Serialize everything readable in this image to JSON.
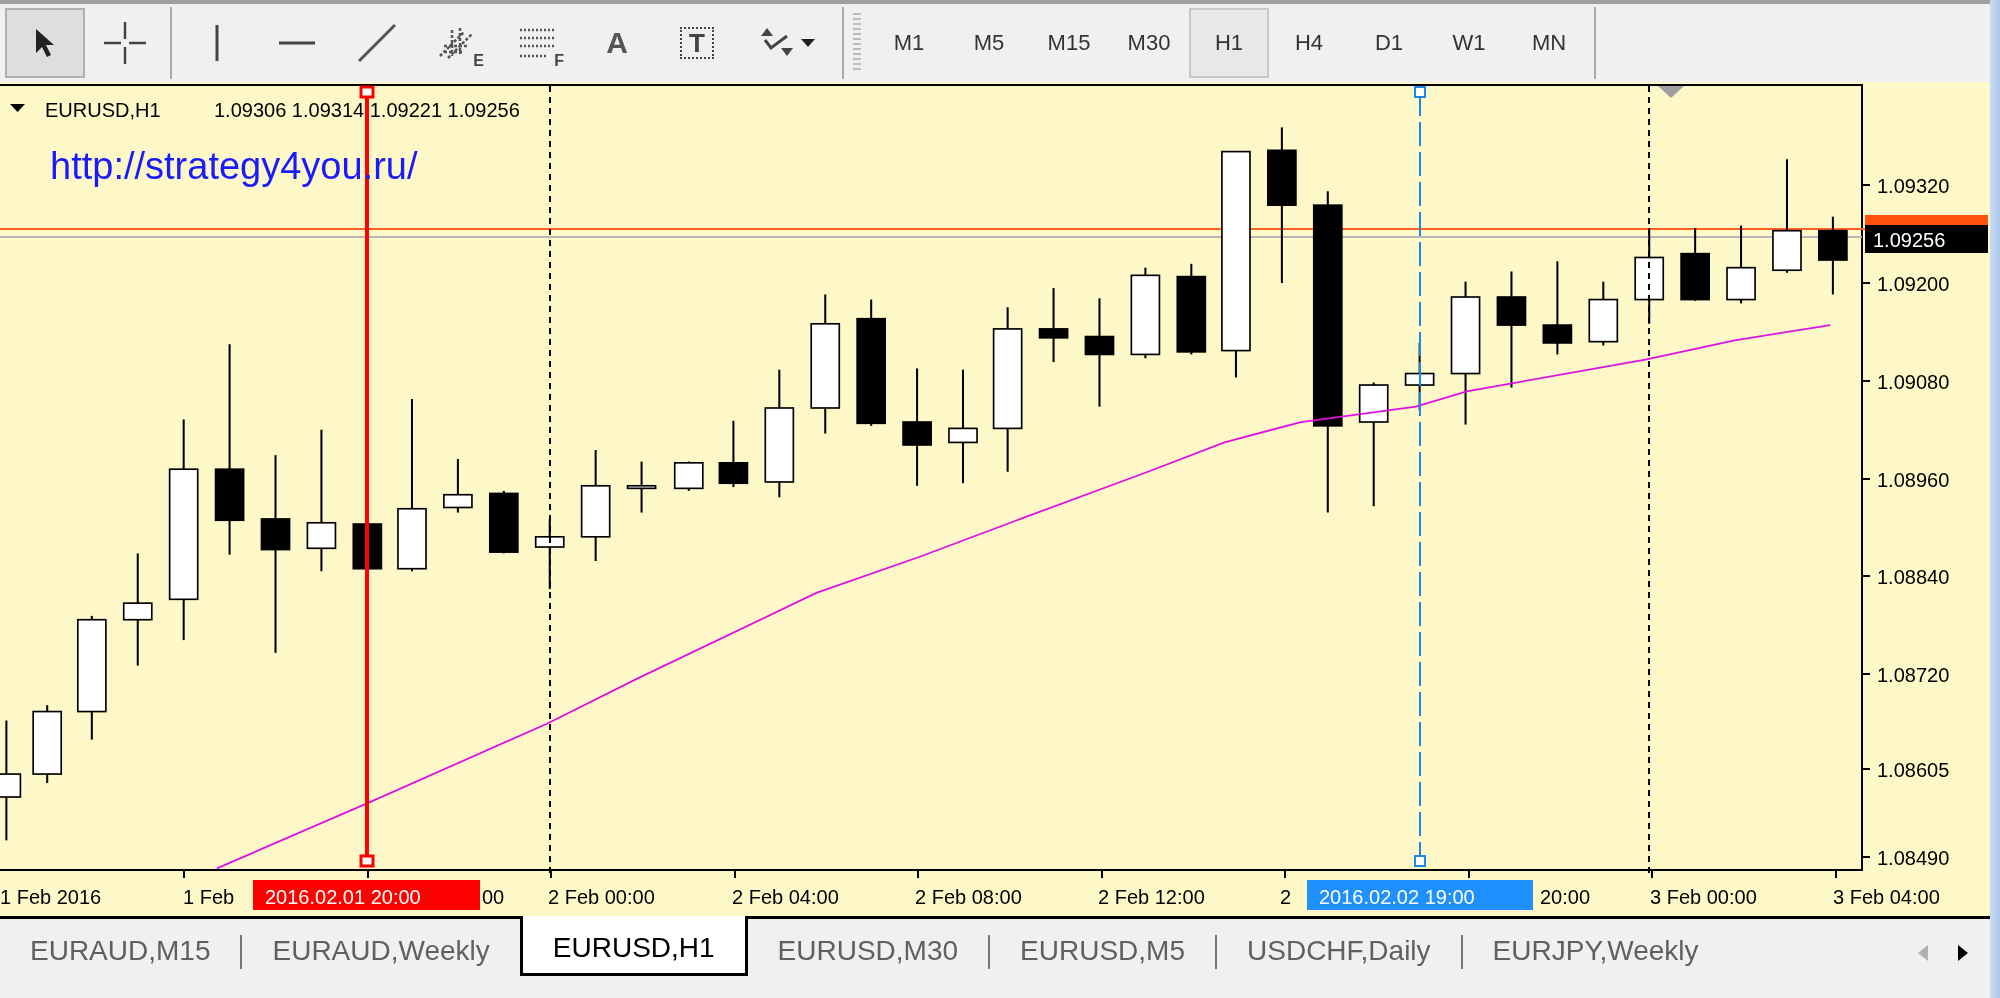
{
  "toolbar": {
    "tools": [
      {
        "kind": "pointer",
        "selected": true
      },
      {
        "kind": "crosshair",
        "selected": false
      },
      {
        "kind": "vline",
        "selected": false
      },
      {
        "kind": "hline",
        "selected": false
      },
      {
        "kind": "trendline",
        "selected": false
      },
      {
        "kind": "channel",
        "badge": "E",
        "selected": false
      },
      {
        "kind": "fibo",
        "badge": "F",
        "selected": false
      },
      {
        "kind": "text",
        "label": "A",
        "selected": false
      },
      {
        "kind": "textlabel",
        "label": "T",
        "selected": false
      },
      {
        "kind": "arrows",
        "selected": false
      }
    ],
    "timeframes": [
      {
        "label": "M1",
        "selected": false
      },
      {
        "label": "M5",
        "selected": false
      },
      {
        "label": "M15",
        "selected": false
      },
      {
        "label": "M30",
        "selected": false
      },
      {
        "label": "H1",
        "selected": true
      },
      {
        "label": "H4",
        "selected": false
      },
      {
        "label": "D1",
        "selected": false
      },
      {
        "label": "W1",
        "selected": false
      },
      {
        "label": "MN",
        "selected": false
      }
    ]
  },
  "chart": {
    "symbol": "EURUSD,H1",
    "ohlc": "1.09306 1.09314 1.09221 1.09256",
    "url_label": "http://strategy4you.ru/",
    "price_labels": [
      "1.09320",
      "1.09200",
      "1.09080",
      "1.08960",
      "1.08840",
      "1.08720",
      "1.08605",
      "1.08490"
    ],
    "current_price": "1.09256",
    "time_labels": [
      "1 Feb 2016",
      "1 Feb",
      "00",
      "2 Feb 00:00",
      "2 Feb 04:00",
      "2 Feb 08:00",
      "2 Feb 12:00",
      "2",
      "20:00",
      "3 Feb 00:00",
      "3 Feb 04:00"
    ],
    "cursor_labels": [
      {
        "text": "2016.02.01 20:00",
        "color": "#ff0000"
      },
      {
        "text": "2016.02.02 19:00",
        "color": "#1e90ff"
      }
    ]
  },
  "tabs": [
    {
      "label": "EURAUD,M15",
      "selected": false
    },
    {
      "label": "EURAUD,Weekly",
      "selected": false
    },
    {
      "label": "EURUSD,H1",
      "selected": true
    },
    {
      "label": "EURUSD,M30",
      "selected": false
    },
    {
      "label": "EURUSD,M5",
      "selected": false
    },
    {
      "label": "USDCHF,Daily",
      "selected": false
    },
    {
      "label": "EURJPY,Weekly",
      "selected": false
    }
  ],
  "tab_scroll": [
    {
      "kind": "left",
      "disabled": true
    },
    {
      "kind": "right",
      "disabled": false
    }
  ]
}
